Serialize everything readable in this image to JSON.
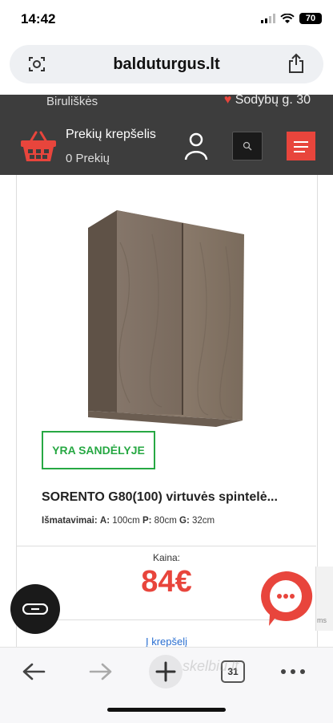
{
  "status_bar": {
    "time": "14:42",
    "battery": "70"
  },
  "browser": {
    "url": "balduturgus.lt",
    "tabs_count": "31"
  },
  "top_strip": {
    "city": "Biruliškės",
    "address": "Sodybų g. 30"
  },
  "header": {
    "cart_title": "Prekių krepšelis",
    "cart_count": "0 Prekių"
  },
  "product": {
    "stock_badge": "YRA SANDĖLYJE",
    "name": "SORENTO G80(100) virtuvės spintelė...",
    "dims_label": "Išmatavimai:",
    "dims_a_label": "A:",
    "dims_a": "100cm",
    "dims_p_label": "P:",
    "dims_p": "80cm",
    "dims_g_label": "G:",
    "dims_g": "32cm",
    "price_label": "Kaina:",
    "price": "84€",
    "add_to_cart": "Į krepšelį"
  },
  "side_edge_text": "ms",
  "watermark": "skelbiu.lt",
  "colors": {
    "accent": "#e8453c",
    "header_bg": "#3d3d3d",
    "stock_green": "#27a843",
    "link_blue": "#2a6fd1"
  },
  "icons": [
    "basket-icon",
    "user-icon",
    "search-icon",
    "menu-icon",
    "chat-icon",
    "loop-icon",
    "back-icon",
    "forward-icon",
    "plus-icon",
    "more-icon",
    "share-icon",
    "reader-icon"
  ]
}
